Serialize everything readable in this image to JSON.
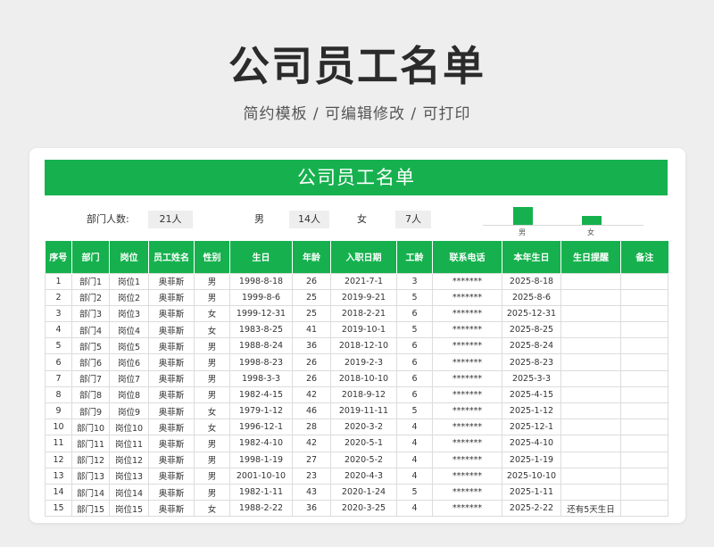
{
  "page": {
    "title": "公司员工名单",
    "subtitle": "简约模板 / 可编辑修改 / 可打印"
  },
  "sheet": {
    "banner": "公司员工名单",
    "dept_count_label": "部门人数:",
    "dept_count_value": "21人",
    "male_label": "男",
    "male_value": "14人",
    "female_label": "女",
    "female_value": "7人"
  },
  "chart_data": {
    "type": "bar",
    "categories": [
      "男",
      "女"
    ],
    "values": [
      14,
      7
    ],
    "ylim": [
      0,
      14
    ]
  },
  "colors": {
    "accent": "#16b14e",
    "header_text": "#ffffff"
  },
  "table": {
    "columns": [
      "序号",
      "部门",
      "岗位",
      "员工姓名",
      "性别",
      "生日",
      "年龄",
      "入职日期",
      "工龄",
      "联系电话",
      "本年生日",
      "生日提醒",
      "备注"
    ],
    "rows": [
      [
        "1",
        "部门1",
        "岗位1",
        "奥菲斯",
        "男",
        "1998-8-18",
        "26",
        "2021-7-1",
        "3",
        "*******",
        "2025-8-18",
        "",
        ""
      ],
      [
        "2",
        "部门2",
        "岗位2",
        "奥菲斯",
        "男",
        "1999-8-6",
        "25",
        "2019-9-21",
        "5",
        "*******",
        "2025-8-6",
        "",
        ""
      ],
      [
        "3",
        "部门3",
        "岗位3",
        "奥菲斯",
        "女",
        "1999-12-31",
        "25",
        "2018-2-21",
        "6",
        "*******",
        "2025-12-31",
        "",
        ""
      ],
      [
        "4",
        "部门4",
        "岗位4",
        "奥菲斯",
        "女",
        "1983-8-25",
        "41",
        "2019-10-1",
        "5",
        "*******",
        "2025-8-25",
        "",
        ""
      ],
      [
        "5",
        "部门5",
        "岗位5",
        "奥菲斯",
        "男",
        "1988-8-24",
        "36",
        "2018-12-10",
        "6",
        "*******",
        "2025-8-24",
        "",
        ""
      ],
      [
        "6",
        "部门6",
        "岗位6",
        "奥菲斯",
        "男",
        "1998-8-23",
        "26",
        "2019-2-3",
        "6",
        "*******",
        "2025-8-23",
        "",
        ""
      ],
      [
        "7",
        "部门7",
        "岗位7",
        "奥菲斯",
        "男",
        "1998-3-3",
        "26",
        "2018-10-10",
        "6",
        "*******",
        "2025-3-3",
        "",
        ""
      ],
      [
        "8",
        "部门8",
        "岗位8",
        "奥菲斯",
        "男",
        "1982-4-15",
        "42",
        "2018-9-12",
        "6",
        "*******",
        "2025-4-15",
        "",
        ""
      ],
      [
        "9",
        "部门9",
        "岗位9",
        "奥菲斯",
        "女",
        "1979-1-12",
        "46",
        "2019-11-11",
        "5",
        "*******",
        "2025-1-12",
        "",
        ""
      ],
      [
        "10",
        "部门10",
        "岗位10",
        "奥菲斯",
        "女",
        "1996-12-1",
        "28",
        "2020-3-2",
        "4",
        "*******",
        "2025-12-1",
        "",
        ""
      ],
      [
        "11",
        "部门11",
        "岗位11",
        "奥菲斯",
        "男",
        "1982-4-10",
        "42",
        "2020-5-1",
        "4",
        "*******",
        "2025-4-10",
        "",
        ""
      ],
      [
        "12",
        "部门12",
        "岗位12",
        "奥菲斯",
        "男",
        "1998-1-19",
        "27",
        "2020-5-2",
        "4",
        "*******",
        "2025-1-19",
        "",
        ""
      ],
      [
        "13",
        "部门13",
        "岗位13",
        "奥菲斯",
        "男",
        "2001-10-10",
        "23",
        "2020-4-3",
        "4",
        "*******",
        "2025-10-10",
        "",
        ""
      ],
      [
        "14",
        "部门14",
        "岗位14",
        "奥菲斯",
        "男",
        "1982-1-11",
        "43",
        "2020-1-24",
        "5",
        "*******",
        "2025-1-11",
        "",
        ""
      ],
      [
        "15",
        "部门15",
        "岗位15",
        "奥菲斯",
        "女",
        "1988-2-22",
        "36",
        "2020-3-25",
        "4",
        "*******",
        "2025-2-22",
        "还有5天生日",
        ""
      ]
    ]
  }
}
